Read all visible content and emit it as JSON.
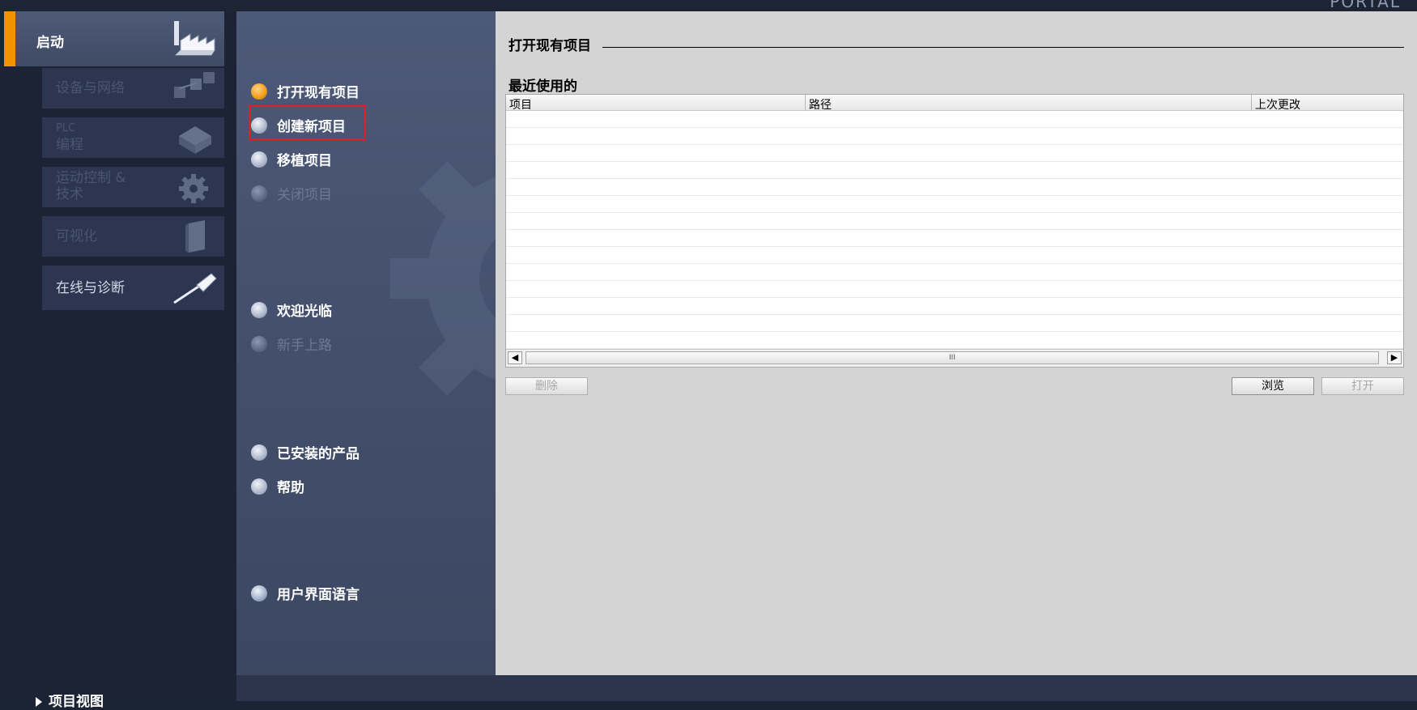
{
  "brand": "PORTAL",
  "left_nav": {
    "start": {
      "label": "启动",
      "icon": "factory-icon"
    },
    "tiles": [
      {
        "label_line1": "设备与网络",
        "label_line2": "",
        "icon": "network-devices-icon",
        "enabled": false
      },
      {
        "label_line1": "PLC",
        "label_line2": "编程",
        "icon": "plc-cube-icon",
        "enabled": false
      },
      {
        "label_line1": "运动控制 &",
        "label_line2": "技术",
        "icon": "gear-icon",
        "enabled": false
      },
      {
        "label_line1": "可视化",
        "label_line2": "",
        "icon": "panel-icon",
        "enabled": false
      },
      {
        "label_line1": "在线与诊断",
        "label_line2": "",
        "icon": "screwdriver-icon",
        "enabled": true
      }
    ],
    "project_view": "项目视图"
  },
  "menu": {
    "items": [
      {
        "label": "打开现有项目",
        "state": "selected"
      },
      {
        "label": "创建新项目",
        "state": "normal"
      },
      {
        "label": "移植项目",
        "state": "normal"
      },
      {
        "label": "关闭项目",
        "state": "disabled"
      },
      {
        "label": "欢迎光临",
        "state": "normal"
      },
      {
        "label": "新手上路",
        "state": "disabled"
      },
      {
        "label": "已安装的产品",
        "state": "normal"
      },
      {
        "label": "帮助",
        "state": "normal"
      },
      {
        "label": "用户界面语言",
        "state": "globe"
      }
    ]
  },
  "content": {
    "section_title": "打开现有项目",
    "recent_title": "最近使用的",
    "columns": [
      "项目",
      "路径",
      "上次更改"
    ],
    "rows": [],
    "buttons": {
      "delete": "删除",
      "browse": "浏览",
      "open": "打开"
    },
    "scroll_grip": "III"
  },
  "colors": {
    "accent": "#f29200",
    "highlight": "#e02020"
  }
}
